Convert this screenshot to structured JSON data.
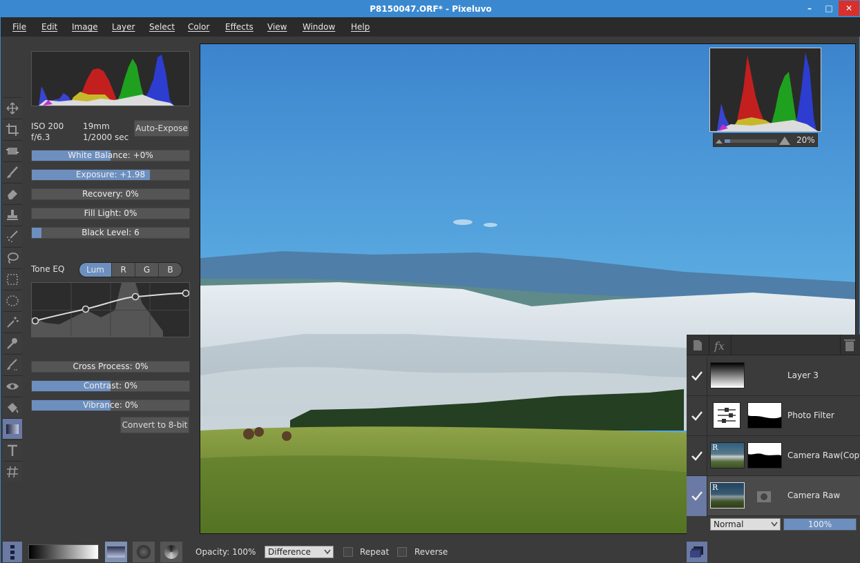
{
  "window": {
    "title": "P8150047.ORF* - Pixeluvo",
    "minimize": "–",
    "maximize": "□",
    "close": "✕"
  },
  "menu": [
    "File",
    "Edit",
    "Image",
    "Layer",
    "Select",
    "Color",
    "Effects",
    "View",
    "Window",
    "Help"
  ],
  "tools": [
    "move-icon",
    "crop-icon",
    "transform-icon",
    "brush-icon",
    "eraser-icon",
    "clone-stamp-icon",
    "heal-icon",
    "lasso-icon",
    "rect-select-icon",
    "ellipse-select-icon",
    "magic-wand-icon",
    "smart-select-icon",
    "selection-brush-icon",
    "red-eye-icon",
    "fill-bucket-icon",
    "gradient-icon",
    "text-icon",
    "grid-icon"
  ],
  "camera": {
    "iso": "ISO 200",
    "focal": "19mm",
    "aperture": "f/6.3",
    "shutter": "1/2000 sec",
    "auto_expose": "Auto-Expose"
  },
  "sliders": [
    {
      "label": "White Balance: +0%",
      "fill": 0.5
    },
    {
      "label": "Exposure: +1.98",
      "fill": 0.75
    },
    {
      "label": "Recovery: 0%",
      "fill": 0
    },
    {
      "label": "Fill Light: 0%",
      "fill": 0
    },
    {
      "label": "Black Level: 6",
      "fill": 0.06
    }
  ],
  "tone_eq": {
    "label": "Tone EQ",
    "tabs": [
      "Lum",
      "R",
      "G",
      "B"
    ],
    "active": "Lum"
  },
  "sliders2": [
    {
      "label": "Cross Process: 0%",
      "fill": 0
    },
    {
      "label": "Contrast: 0%",
      "fill": 0.5
    },
    {
      "label": "Vibrance: 0%",
      "fill": 0.5
    }
  ],
  "convert_button": "Convert to 8-bit",
  "zoom": {
    "value": "20%",
    "fill": 0.1
  },
  "layers": [
    {
      "name": "Layer 3"
    },
    {
      "name": "Photo Filter"
    },
    {
      "name": "Camera Raw(Copy)"
    },
    {
      "name": "Camera Raw"
    }
  ],
  "layer_blend": "Normal",
  "layer_opacity": "100%",
  "bottom": {
    "opacity": "Opacity: 100%",
    "mode": "Difference",
    "repeat": "Repeat",
    "reverse": "Reverse"
  },
  "colors": {
    "accent": "#3a89d0",
    "slider_fill": "#6c8fbf",
    "close": "#d9302c"
  }
}
